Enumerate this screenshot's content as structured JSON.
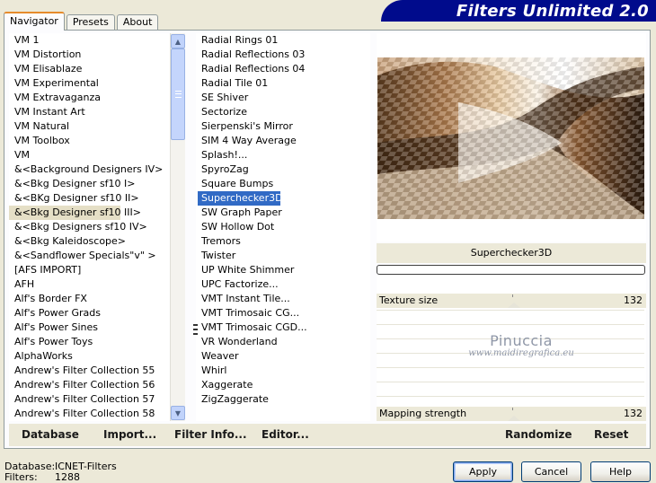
{
  "app": {
    "title": "Filters Unlimited 2.0"
  },
  "tabs": [
    {
      "label": "Navigator",
      "active": true
    },
    {
      "label": "Presets",
      "active": false
    },
    {
      "label": "About",
      "active": false
    }
  ],
  "categories": {
    "items": [
      "VM 1",
      "VM Distortion",
      "VM Elisablaze",
      "VM Experimental",
      "VM Extravaganza",
      "VM Instant Art",
      "VM Natural",
      "VM Toolbox",
      "VM",
      "&<Background Designers IV>",
      "&<Bkg Designer sf10 I>",
      "&<BKg Designer sf10 II>",
      "&<Bkg Designer sf10 III>",
      "&<Bkg Designers sf10 IV>",
      "&<Bkg Kaleidoscope>",
      "&<Sandflower Specials\"v\" >",
      "[AFS IMPORT]",
      "AFH",
      "Alf's Border FX",
      "Alf's Power Grads",
      "Alf's Power Sines",
      "Alf's Power Toys",
      "AlphaWorks",
      "Andrew's Filter Collection 55",
      "Andrew's Filter Collection 56",
      "Andrew's Filter Collection 57",
      "Andrew's Filter Collection 58"
    ],
    "selected": "&<Bkg Designer sf10 III>"
  },
  "filters": {
    "items": [
      "Radial  Rings 01",
      "Radial Reflections 03",
      "Radial Reflections 04",
      "Radial Tile 01",
      "SE Shiver",
      "Sectorize",
      "Sierpenski's Mirror",
      "SIM 4 Way Average",
      "Splash!...",
      "SpyroZag",
      "Square Bumps",
      "Superchecker3D",
      "SW Graph Paper",
      "SW Hollow Dot",
      "Tremors",
      "Twister",
      "UP White Shimmer",
      "UPC Factorize...",
      "VMT Instant Tile...",
      "VMT Trimosaic CG...",
      "VMT Trimosaic CGD...",
      "VR Wonderland",
      "Weaver",
      "Whirl",
      "Xaggerate",
      "ZigZaggerate"
    ],
    "selected": "Superchecker3D"
  },
  "filter_panel": {
    "name": "Superchecker3D",
    "params": [
      {
        "label": "Texture size",
        "value": "132"
      },
      {
        "label": "Mapping strength",
        "value": "132"
      }
    ]
  },
  "watermark": {
    "line1": "Pinuccia",
    "line2": "www.maidiregrafica.eu"
  },
  "actions": {
    "database": "Database",
    "import": "Import...",
    "filter_info": "Filter Info...",
    "editor": "Editor...",
    "randomize": "Randomize",
    "reset": "Reset"
  },
  "status": {
    "database_label": "Database:",
    "database_value": "ICNET-Filters",
    "filters_label": "Filters:",
    "filters_value": "1288"
  },
  "buttons": {
    "apply": "Apply",
    "cancel": "Cancel",
    "help": "Help"
  },
  "colors": {
    "banner": "#000b8c",
    "selection": "#316ac5",
    "tab_accent": "#e68b2c"
  }
}
